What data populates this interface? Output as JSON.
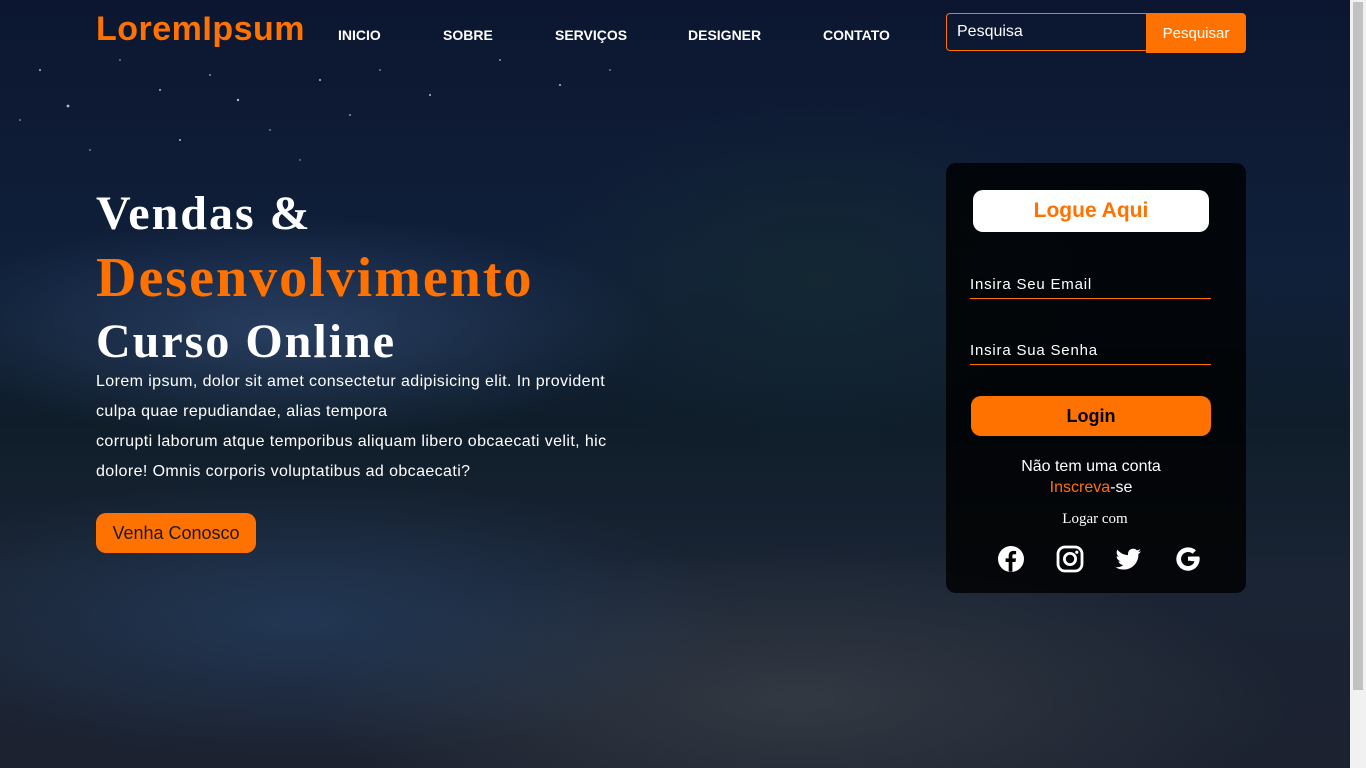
{
  "header": {
    "logo": "LoremIpsum",
    "nav": [
      "INICIO",
      "SOBRE",
      "SERVIÇOS",
      "DESIGNER",
      "CONTATO"
    ],
    "search": {
      "placeholder": "Pesquisa",
      "button": "Pesquisar"
    }
  },
  "hero": {
    "line1": "Vendas &",
    "line2": "Desenvolvimento",
    "line3": "Curso Online",
    "paragraph": [
      "Lorem ipsum, dolor sit amet consectetur adipisicing elit. In provident",
      "culpa quae repudiandae, alias tempora",
      "corrupti laborum atque temporibus aliquam libero obcaecati velit, hic",
      "dolore! Omnis corporis voluptatibus ad obcaecati?"
    ],
    "cta": "Venha Conosco"
  },
  "login": {
    "title": "Logue Aqui",
    "email_placeholder": "Insira Seu Email",
    "password_placeholder": "Insira Sua Senha",
    "button": "Login",
    "no_account": "Não tem uma conta",
    "signup_link": "Inscreva",
    "signup_suffix": "-se",
    "login_with": "Logar com",
    "socials": [
      "facebook-icon",
      "instagram-icon",
      "twitter-icon",
      "google-icon"
    ]
  },
  "colors": {
    "accent": "#ff7200",
    "card": "#000000"
  }
}
